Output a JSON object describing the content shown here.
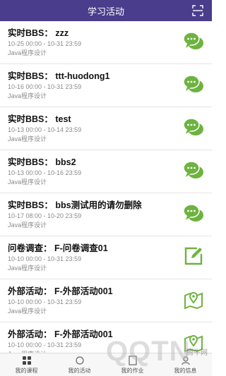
{
  "header": {
    "title": "学习活动",
    "action_icon": "scan-icon"
  },
  "activities": [
    {
      "title": "实时BBS：  zzz",
      "time": "10-25 00:00 - 10-31 23:59",
      "course": "Java程序设计",
      "icon": "chat-icon"
    },
    {
      "title": "实时BBS：  ttt-huodong1",
      "time": "10-16 00:00 - 10-31 23:59",
      "course": "Java程序设计",
      "icon": "chat-icon"
    },
    {
      "title": "实时BBS：  test",
      "time": "10-13 00:00 - 10-14 23:59",
      "course": "Java程序设计",
      "icon": "chat-icon"
    },
    {
      "title": "实时BBS：  bbs2",
      "time": "10-13 00:00 - 10-16 23:59",
      "course": "Java程序设计",
      "icon": "chat-icon"
    },
    {
      "title": "实时BBS：  bbs测试用的请勿删除",
      "time": "10-17 08:00 - 10-20 23:59",
      "course": "Java程序设计",
      "icon": "chat-icon"
    },
    {
      "title": "问卷调查：  F-问卷调查01",
      "time": "10-10 00:00 - 10-31 23:59",
      "course": "Java程序设计",
      "icon": "edit-icon"
    },
    {
      "title": "外部活动：  F-外部活动001",
      "time": "10-10 00:00 - 10-31 23:59",
      "course": "Java程序设计",
      "icon": "map-pin-icon"
    },
    {
      "title": "外部活动：  F-外部活动001",
      "time": "10-10 00:00 - 10-31 23:59",
      "course": "Java程序设计",
      "icon": "map-pin-icon"
    }
  ],
  "bottom_nav": [
    {
      "label": "我的课程",
      "icon": "grid-icon"
    },
    {
      "label": "我的活动",
      "icon": "activity-icon"
    },
    {
      "label": "我的作业",
      "icon": "homework-icon"
    },
    {
      "label": "我的信息",
      "icon": "user-icon"
    }
  ],
  "watermark": {
    "text": "QQTN",
    "sub": "腾牛网"
  },
  "colors": {
    "header": "#4a3d8c",
    "accent_green": "#6db33f"
  }
}
